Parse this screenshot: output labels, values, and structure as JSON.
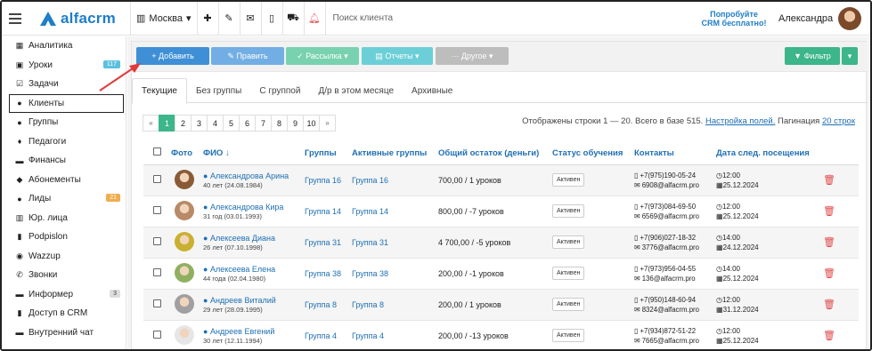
{
  "topbar": {
    "logo": "alfacrm",
    "branch": "Москва",
    "search_placeholder": "Поиск клиента",
    "promo_line1": "Попробуйте",
    "promo_line2": "CRM бесплатно!",
    "user_name": "Александра"
  },
  "sidebar": {
    "items": [
      {
        "label": "Аналитика",
        "icon": "chart-icon",
        "glyph": "▦"
      },
      {
        "label": "Уроки",
        "icon": "calendar-icon",
        "glyph": "▣",
        "badge": "117"
      },
      {
        "label": "Задачи",
        "icon": "tasks-icon",
        "glyph": "☑"
      },
      {
        "label": "Клиенты",
        "icon": "user-icon",
        "glyph": "●"
      },
      {
        "label": "Группы",
        "icon": "group-icon",
        "glyph": "●"
      },
      {
        "label": "Педагоги",
        "icon": "teacher-icon",
        "glyph": "♦"
      },
      {
        "label": "Финансы",
        "icon": "money-icon",
        "glyph": "▬"
      },
      {
        "label": "Абонементы",
        "icon": "tag-icon",
        "glyph": "◆"
      },
      {
        "label": "Лиды",
        "icon": "leads-icon",
        "glyph": "●",
        "badge": "21"
      },
      {
        "label": "Юр. лица",
        "icon": "building-icon",
        "glyph": "▥"
      },
      {
        "label": "Podpislon",
        "icon": "document-icon",
        "glyph": "▮"
      },
      {
        "label": "Wazzup",
        "icon": "whatsapp-icon",
        "glyph": "◉"
      },
      {
        "label": "Звонки",
        "icon": "phone-icon",
        "glyph": "✆"
      },
      {
        "label": "Информер",
        "icon": "informer-icon",
        "glyph": "▬",
        "badge": "3"
      },
      {
        "label": "Доступ в CRM",
        "icon": "lock-icon",
        "glyph": "▮"
      },
      {
        "label": "Внутренний чат",
        "icon": "chat-icon",
        "glyph": "▬"
      }
    ]
  },
  "toolbar": {
    "add": "+ Добавить",
    "edit": "✎ Править",
    "mail": "✓ Рассылка ▾",
    "reports": "▤ Отчеты ▾",
    "other": "··· Другое ▾",
    "filter": "▼ Фильтр",
    "filter_caret": "▾"
  },
  "tabs": [
    "Текущие",
    "Без группы",
    "С группой",
    "Д/р в этом месяце",
    "Архивные"
  ],
  "pagination": {
    "prev": "«",
    "pages": [
      "1",
      "2",
      "3",
      "4",
      "5",
      "6",
      "7",
      "8",
      "9",
      "10"
    ],
    "next": "»"
  },
  "rows_info": {
    "text": "Отображены строки 1 — 20. Всего в базе 515.",
    "settings_link": "Настройка полей.",
    "pagination_label": "Пагинация",
    "pagination_value": "20 строк"
  },
  "table": {
    "headers": [
      "Фото",
      "ФИО ↓",
      "Группы",
      "Активные группы",
      "Общий остаток (деньги)",
      "Статус обучения",
      "Контакты",
      "Дата след. посещения"
    ],
    "rows": [
      {
        "name": "Александрова Арина",
        "age": "40 лет (24.08.1984)",
        "group": "Группа 16",
        "active_group": "Группа 16",
        "balance": "700,00 / 1 уроков",
        "status": "Активен",
        "phone": "+7(975)190-05-24",
        "email": "6908@alfacrm.pro",
        "time": "12:00",
        "date": "25.12.2024",
        "photo_color": "#8a5a36"
      },
      {
        "name": "Александрова Кира",
        "age": "31 год (03.01.1993)",
        "group": "Группа 14",
        "active_group": "Группа 14",
        "balance": "800,00 / -7 уроков",
        "status": "Активен",
        "phone": "+7(973)084-69-50",
        "email": "6569@alfacrm.pro",
        "time": "12:00",
        "date": "25.12.2024",
        "photo_color": "#b88a66"
      },
      {
        "name": "Алексеева Диана",
        "age": "26 лет (07.10.1998)",
        "group": "Группа 31",
        "active_group": "Группа 31",
        "balance": "4 700,00 / -5 уроков",
        "status": "Активен",
        "phone": "+7(906)027-18-32",
        "email": "3776@alfacrm.pro",
        "time": "14:00",
        "date": "24.12.2024",
        "photo_color": "#c9b030"
      },
      {
        "name": "Алексеева Елена",
        "age": "44 года (02.04.1980)",
        "group": "Группа 38",
        "active_group": "Группа 38",
        "balance": "200,00 / -1 уроков",
        "status": "Активен",
        "phone": "+7(973)956-04-55",
        "email": "136@alfacrm.pro",
        "time": "14:00",
        "date": "25.12.2024",
        "photo_color": "#8fb060"
      },
      {
        "name": "Андреев Виталий",
        "age": "29 лет (28.09.1995)",
        "group": "Группа 8",
        "active_group": "Группа 8",
        "balance": "200,00 / 1 уроков",
        "status": "Активен",
        "phone": "+7(950)148-60-94",
        "email": "8324@alfacrm.pro",
        "time": "12:00",
        "date": "31.12.2024",
        "photo_color": "#a0a0a0"
      },
      {
        "name": "Андреев Евгений",
        "age": "30 лет (12.11.1994)",
        "group": "Группа 4",
        "active_group": "Группа 4",
        "balance": "200,00 / -13 уроков",
        "status": "Активен",
        "phone": "+7(934)872-51-22",
        "email": "7665@alfacrm.pro",
        "time": "12:00",
        "date": "25.12.2024",
        "photo_color": "#e6e6e6"
      }
    ]
  },
  "colors": {
    "accent": "#3f8fd6",
    "green": "#3cb68a",
    "link": "#1e6fb3",
    "annotation_arrow": "#e03a3a"
  }
}
